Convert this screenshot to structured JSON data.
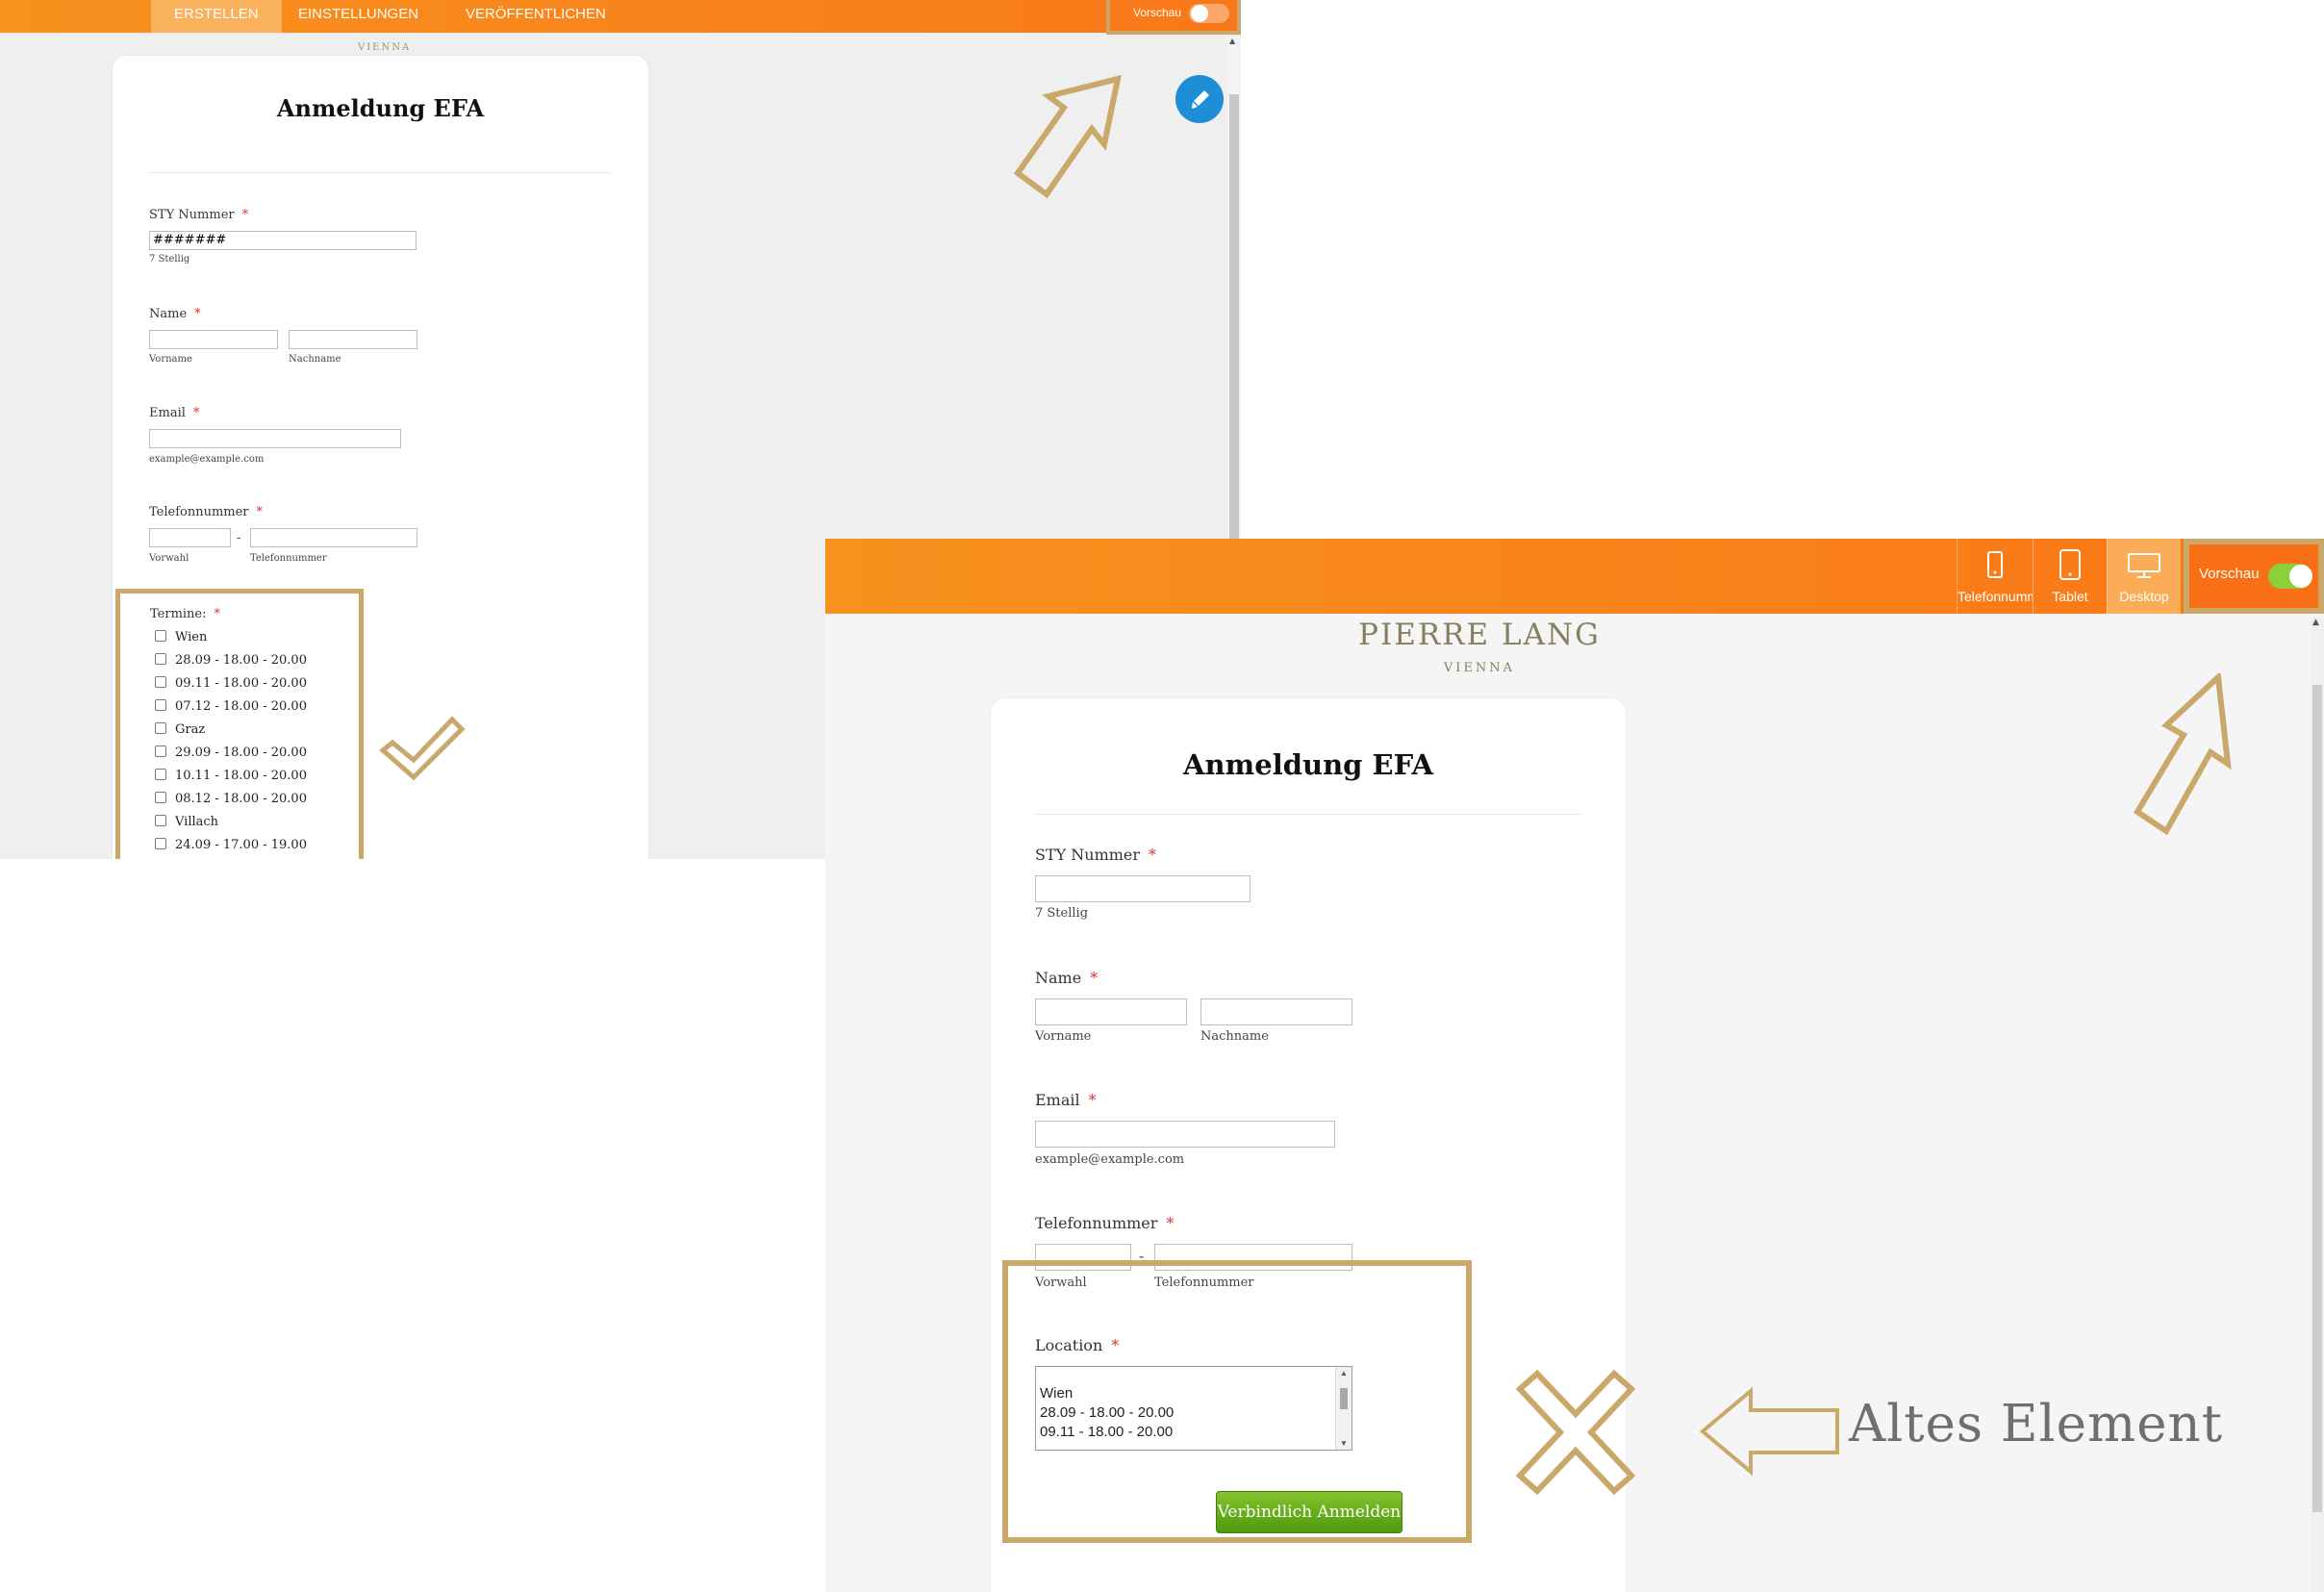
{
  "top_shot": {
    "tabs": [
      "ERSTELLEN",
      "EINSTELLUNGEN",
      "VERÖFFENTLICHEN"
    ],
    "preview_label": "Vorschau",
    "brand_sub": "VIENNA",
    "form_title": "Anmeldung EFA",
    "sty_label": "STY Nummer",
    "sty_value": "#######",
    "sty_hint": "7 Stellig",
    "name_label": "Name",
    "first_name_hint": "Vorname",
    "last_name_hint": "Nachname",
    "email_label": "Email",
    "email_hint": "example@example.com",
    "phone_label": "Telefonnummer",
    "phone_sep": "-",
    "area_code_hint": "Vorwahl",
    "phone_number_hint": "Telefonnummer",
    "dates_label": "Termine:",
    "required_mark": "*",
    "dates": [
      "Wien",
      "28.09 - 18.00 - 20.00",
      "09.11 - 18.00 - 20.00",
      "07.12 - 18.00 - 20.00",
      "Graz",
      "29.09 - 18.00 - 20.00",
      "10.11 - 18.00 - 20.00",
      "08.12 - 18.00 - 20.00",
      "Villach",
      "24.09 - 17.00 - 19.00"
    ]
  },
  "bottom_shot": {
    "devices": [
      "Telefonnummer",
      "Tablet",
      "Desktop"
    ],
    "preview_label": "Vorschau",
    "brand": "PIERRE LANG",
    "brand_sub": "VIENNA",
    "form_title": "Anmeldung EFA",
    "sty_label": "STY Nummer",
    "sty_hint": "7 Stellig",
    "name_label": "Name",
    "first_name_hint": "Vorname",
    "last_name_hint": "Nachname",
    "email_label": "Email",
    "email_hint": "example@example.com",
    "phone_label": "Telefonnummer",
    "phone_sep": "-",
    "area_code_hint": "Vorwahl",
    "phone_number_hint": "Telefonnummer",
    "location_label": "Location",
    "required_mark": "*",
    "location_options": [
      "Wien",
      "28.09 - 18.00 - 20.00",
      "09.11 - 18.00 - 20.00"
    ],
    "submit_label": "Verbindlich Anmelden",
    "annotation_caption": "Altes Element"
  },
  "colors": {
    "orange_bar": "#f7921e",
    "annotation_gold": "#c9a86a",
    "fab_blue": "#1e8fd6",
    "submit_green": "#5fa81a",
    "required_red": "#d33333"
  }
}
